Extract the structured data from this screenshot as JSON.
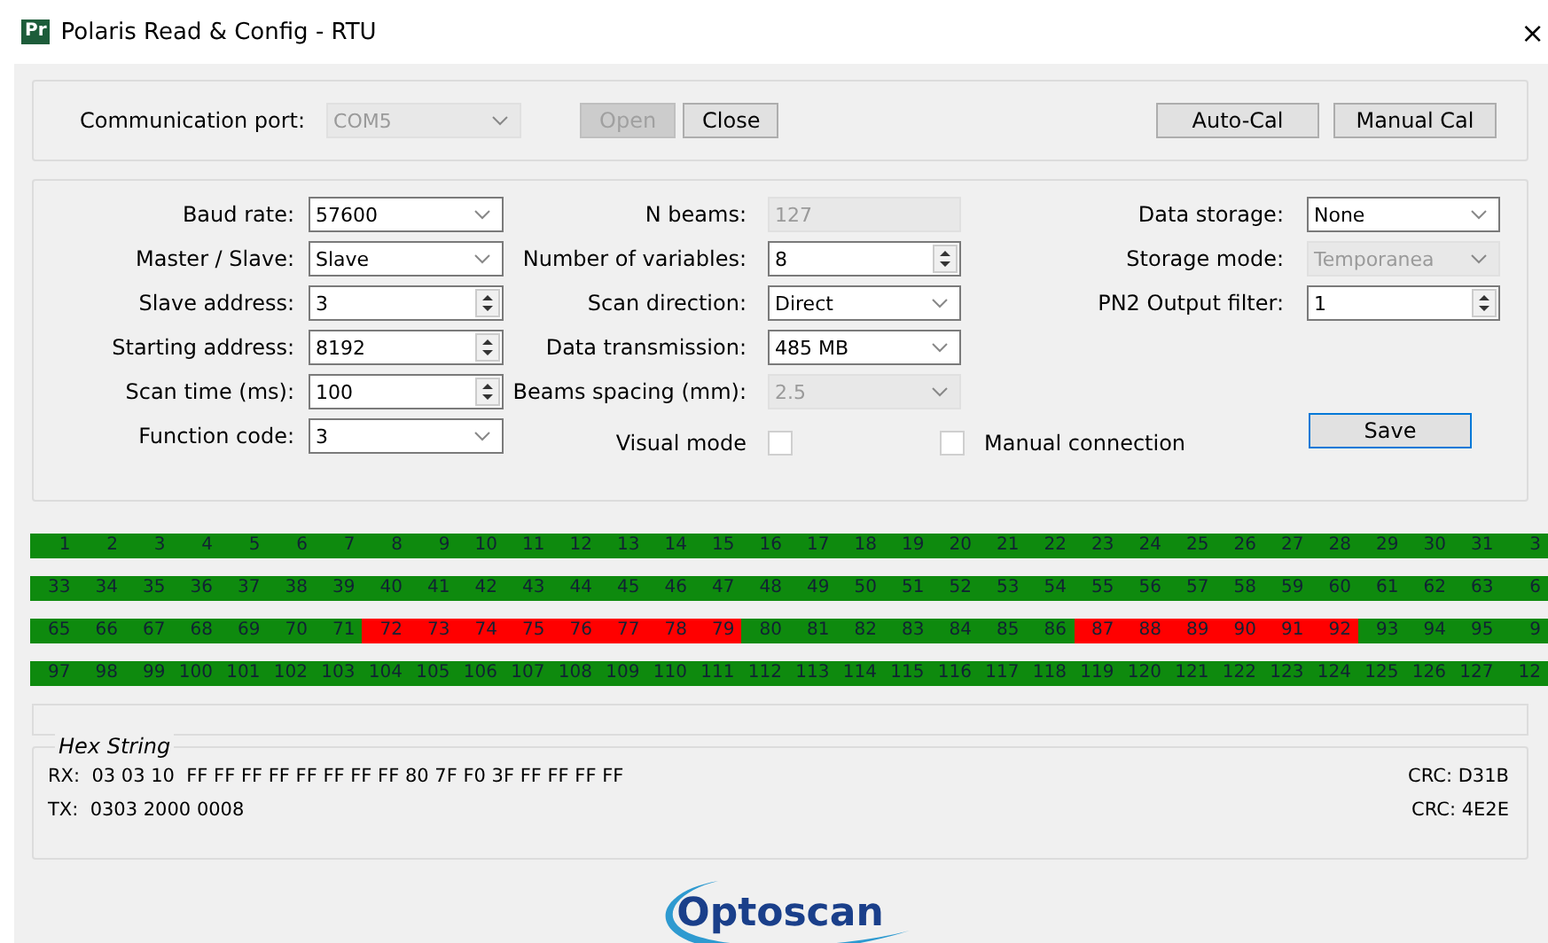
{
  "window": {
    "icon_text": "Pr",
    "title": "Polaris Read & Config - RTU",
    "close": "×"
  },
  "connection": {
    "label": "Communication port:",
    "port": {
      "value": "COM5",
      "disabled": true
    },
    "buttons": [
      {
        "label": "Open",
        "disabled": true
      },
      {
        "label": "Close",
        "disabled": false
      }
    ],
    "cal_buttons": [
      {
        "label": "Auto-Cal"
      },
      {
        "label": "Manual Cal"
      }
    ]
  },
  "settings": {
    "rows": [
      [
        {
          "kind": "combo",
          "label": "Baud rate:",
          "value": "57600",
          "disabled": false
        },
        {
          "kind": "text",
          "label": "N beams:",
          "value": "127",
          "disabled": true
        },
        {
          "kind": "combo",
          "label": "Data storage:",
          "value": "None",
          "disabled": false
        }
      ],
      [
        {
          "kind": "combo",
          "label": "Master / Slave:",
          "value": "Slave",
          "disabled": false
        },
        {
          "kind": "spin",
          "label": "Number of variables:",
          "value": "8",
          "disabled": false
        },
        {
          "kind": "combo",
          "label": "Storage mode:",
          "value": "Temporanea",
          "disabled": true
        }
      ],
      [
        {
          "kind": "spin",
          "label": "Slave address:",
          "value": "3",
          "disabled": false
        },
        {
          "kind": "combo",
          "label": "Scan direction:",
          "value": "Direct",
          "disabled": false
        },
        {
          "kind": "spin",
          "label": "PN2 Output filter:",
          "value": "1",
          "disabled": false
        }
      ],
      [
        {
          "kind": "spin",
          "label": "Starting address:",
          "value": "8192",
          "disabled": false
        },
        {
          "kind": "combo",
          "label": "Data transmission:",
          "value": "485 MB",
          "disabled": false
        }
      ],
      [
        {
          "kind": "spin",
          "label": "Scan time (ms):",
          "value": "100",
          "disabled": false
        },
        {
          "kind": "combo",
          "label": "Beams spacing (mm):",
          "value": "2.5",
          "disabled": true
        }
      ],
      [
        {
          "kind": "combo",
          "label": "Function code:",
          "value": "3",
          "disabled": false
        },
        {
          "kind": "check",
          "label": "Visual mode",
          "checked": false
        },
        {
          "kind": "check",
          "label": "Manual connection",
          "checked": false
        },
        {
          "kind": "button",
          "label": "Save"
        }
      ]
    ]
  },
  "beams": [
    [
      {
        "n": "1",
        "blocked": false
      },
      {
        "n": "2",
        "blocked": false
      },
      {
        "n": "3",
        "blocked": false
      },
      {
        "n": "4",
        "blocked": false
      },
      {
        "n": "5",
        "blocked": false
      },
      {
        "n": "6",
        "blocked": false
      },
      {
        "n": "7",
        "blocked": false
      },
      {
        "n": "8",
        "blocked": false
      },
      {
        "n": "9",
        "blocked": false
      },
      {
        "n": "10",
        "blocked": false
      },
      {
        "n": "11",
        "blocked": false
      },
      {
        "n": "12",
        "blocked": false
      },
      {
        "n": "13",
        "blocked": false
      },
      {
        "n": "14",
        "blocked": false
      },
      {
        "n": "15",
        "blocked": false
      },
      {
        "n": "16",
        "blocked": false
      },
      {
        "n": "17",
        "blocked": false
      },
      {
        "n": "18",
        "blocked": false
      },
      {
        "n": "19",
        "blocked": false
      },
      {
        "n": "20",
        "blocked": false
      },
      {
        "n": "21",
        "blocked": false
      },
      {
        "n": "22",
        "blocked": false
      },
      {
        "n": "23",
        "blocked": false
      },
      {
        "n": "24",
        "blocked": false
      },
      {
        "n": "25",
        "blocked": false
      },
      {
        "n": "26",
        "blocked": false
      },
      {
        "n": "27",
        "blocked": false
      },
      {
        "n": "28",
        "blocked": false
      },
      {
        "n": "29",
        "blocked": false
      },
      {
        "n": "30",
        "blocked": false
      },
      {
        "n": "31",
        "blocked": false
      },
      {
        "n": "3",
        "blocked": false
      }
    ],
    [
      {
        "n": "33",
        "blocked": false
      },
      {
        "n": "34",
        "blocked": false
      },
      {
        "n": "35",
        "blocked": false
      },
      {
        "n": "36",
        "blocked": false
      },
      {
        "n": "37",
        "blocked": false
      },
      {
        "n": "38",
        "blocked": false
      },
      {
        "n": "39",
        "blocked": false
      },
      {
        "n": "40",
        "blocked": false
      },
      {
        "n": "41",
        "blocked": false
      },
      {
        "n": "42",
        "blocked": false
      },
      {
        "n": "43",
        "blocked": false
      },
      {
        "n": "44",
        "blocked": false
      },
      {
        "n": "45",
        "blocked": false
      },
      {
        "n": "46",
        "blocked": false
      },
      {
        "n": "47",
        "blocked": false
      },
      {
        "n": "48",
        "blocked": false
      },
      {
        "n": "49",
        "blocked": false
      },
      {
        "n": "50",
        "blocked": false
      },
      {
        "n": "51",
        "blocked": false
      },
      {
        "n": "52",
        "blocked": false
      },
      {
        "n": "53",
        "blocked": false
      },
      {
        "n": "54",
        "blocked": false
      },
      {
        "n": "55",
        "blocked": false
      },
      {
        "n": "56",
        "blocked": false
      },
      {
        "n": "57",
        "blocked": false
      },
      {
        "n": "58",
        "blocked": false
      },
      {
        "n": "59",
        "blocked": false
      },
      {
        "n": "60",
        "blocked": false
      },
      {
        "n": "61",
        "blocked": false
      },
      {
        "n": "62",
        "blocked": false
      },
      {
        "n": "63",
        "blocked": false
      },
      {
        "n": "6",
        "blocked": false
      }
    ],
    [
      {
        "n": "65",
        "blocked": false
      },
      {
        "n": "66",
        "blocked": false
      },
      {
        "n": "67",
        "blocked": false
      },
      {
        "n": "68",
        "blocked": false
      },
      {
        "n": "69",
        "blocked": false
      },
      {
        "n": "70",
        "blocked": false
      },
      {
        "n": "71",
        "blocked": false
      },
      {
        "n": "72",
        "blocked": true
      },
      {
        "n": "73",
        "blocked": true
      },
      {
        "n": "74",
        "blocked": true
      },
      {
        "n": "75",
        "blocked": true
      },
      {
        "n": "76",
        "blocked": true
      },
      {
        "n": "77",
        "blocked": true
      },
      {
        "n": "78",
        "blocked": true
      },
      {
        "n": "79",
        "blocked": true
      },
      {
        "n": "80",
        "blocked": false
      },
      {
        "n": "81",
        "blocked": false
      },
      {
        "n": "82",
        "blocked": false
      },
      {
        "n": "83",
        "blocked": false
      },
      {
        "n": "84",
        "blocked": false
      },
      {
        "n": "85",
        "blocked": false
      },
      {
        "n": "86",
        "blocked": false
      },
      {
        "n": "87",
        "blocked": true
      },
      {
        "n": "88",
        "blocked": true
      },
      {
        "n": "89",
        "blocked": true
      },
      {
        "n": "90",
        "blocked": true
      },
      {
        "n": "91",
        "blocked": true
      },
      {
        "n": "92",
        "blocked": true
      },
      {
        "n": "93",
        "blocked": false
      },
      {
        "n": "94",
        "blocked": false
      },
      {
        "n": "95",
        "blocked": false
      },
      {
        "n": "9",
        "blocked": false
      }
    ],
    [
      {
        "n": "97",
        "blocked": false
      },
      {
        "n": "98",
        "blocked": false
      },
      {
        "n": "99",
        "blocked": false
      },
      {
        "n": "100",
        "blocked": false
      },
      {
        "n": "101",
        "blocked": false
      },
      {
        "n": "102",
        "blocked": false
      },
      {
        "n": "103",
        "blocked": false
      },
      {
        "n": "104",
        "blocked": false
      },
      {
        "n": "105",
        "blocked": false
      },
      {
        "n": "106",
        "blocked": false
      },
      {
        "n": "107",
        "blocked": false
      },
      {
        "n": "108",
        "blocked": false
      },
      {
        "n": "109",
        "blocked": false
      },
      {
        "n": "110",
        "blocked": false
      },
      {
        "n": "111",
        "blocked": false
      },
      {
        "n": "112",
        "blocked": false
      },
      {
        "n": "113",
        "blocked": false
      },
      {
        "n": "114",
        "blocked": false
      },
      {
        "n": "115",
        "blocked": false
      },
      {
        "n": "116",
        "blocked": false
      },
      {
        "n": "117",
        "blocked": false
      },
      {
        "n": "118",
        "blocked": false
      },
      {
        "n": "119",
        "blocked": false
      },
      {
        "n": "120",
        "blocked": false
      },
      {
        "n": "121",
        "blocked": false
      },
      {
        "n": "122",
        "blocked": false
      },
      {
        "n": "123",
        "blocked": false
      },
      {
        "n": "124",
        "blocked": false
      },
      {
        "n": "125",
        "blocked": false
      },
      {
        "n": "126",
        "blocked": false
      },
      {
        "n": "127",
        "blocked": false
      },
      {
        "n": "12",
        "blocked": false
      }
    ]
  ],
  "hex": {
    "title": "Hex String",
    "lines": [
      {
        "text": "RX:  03 03 10  FF FF FF FF FF FF FF FF 80 7F F0 3F FF FF FF FF",
        "crc": "CRC: D31B"
      },
      {
        "text": "TX:  0303 2000 0008",
        "crc": "CRC: 4E2E"
      }
    ]
  },
  "logo_text": "Optoscan"
}
